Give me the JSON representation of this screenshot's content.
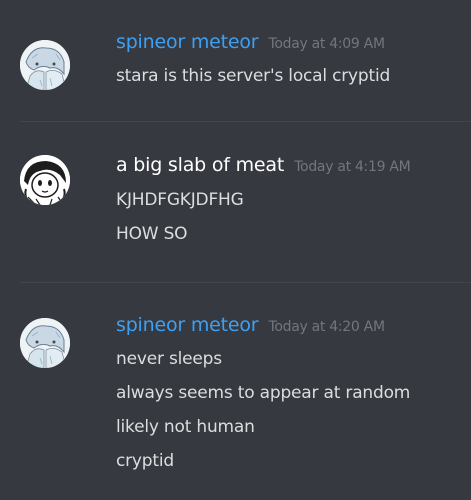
{
  "messages": [
    {
      "username": "spineor meteor",
      "username_color": "#3ea0f3",
      "timestamp": "Today at 4:09 AM",
      "avatar": "anime-sketch-avatar-icon",
      "lines": [
        "stara is this server's local cryptid"
      ]
    },
    {
      "username": "a big slab of meat",
      "username_color": "#ffffff",
      "timestamp": "Today at 4:19 AM",
      "avatar": "doodle-face-avatar-icon",
      "lines": [
        "KJHDFGKJDFHG",
        "HOW SO"
      ]
    },
    {
      "username": "spineor meteor",
      "username_color": "#3ea0f3",
      "timestamp": "Today at 4:20 AM",
      "avatar": "anime-sketch-avatar-icon",
      "lines": [
        "never sleeps",
        "always seems to appear at random",
        "likely not human",
        "cryptid"
      ]
    }
  ]
}
